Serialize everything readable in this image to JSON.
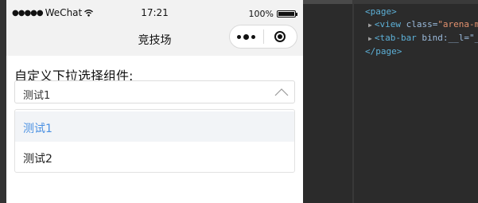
{
  "status_bar": {
    "signal": "●●●●●",
    "carrier": "WeChat",
    "time": "17:21",
    "battery": "100%",
    "battery_level": 1.0
  },
  "nav": {
    "title": "竞技场"
  },
  "picker": {
    "label": "自定义下拉选择组件:",
    "selected": "测试1",
    "options": [
      {
        "label": "测试1",
        "active": true
      },
      {
        "label": "测试2",
        "active": false
      }
    ],
    "active_color": "#4a90e2"
  },
  "devtools": {
    "lines": [
      {
        "tag_open": "<page>"
      },
      {
        "tag": "<view",
        "attr": " class=",
        "val": "\"arena-m"
      },
      {
        "tag": "<tab-bar",
        "attr": " bind:__l=\"_"
      },
      {
        "tag_close": "</page>"
      }
    ]
  }
}
